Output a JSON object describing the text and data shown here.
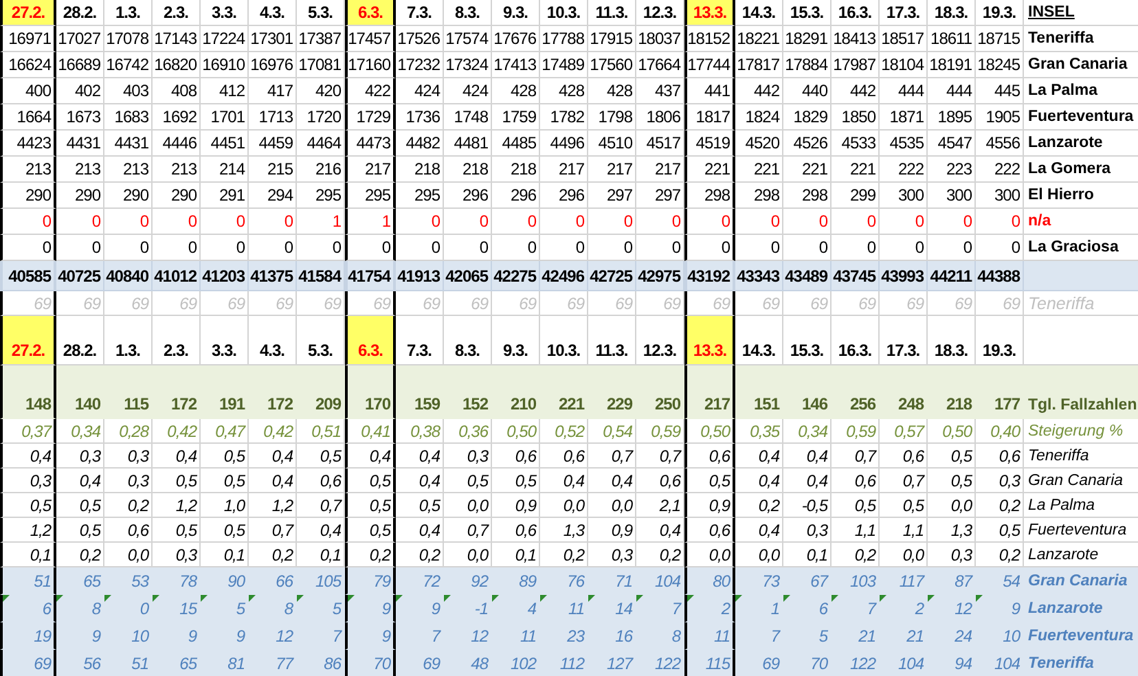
{
  "rows": [
    {
      "kind": "dates",
      "label": "INSEL",
      "cells": [
        {
          "text": "27.2.",
          "highlighted": true
        },
        {
          "text": "28.2.",
          "highlighted": false
        },
        {
          "text": "1.3.",
          "highlighted": false
        },
        {
          "text": "2.3.",
          "highlighted": false
        },
        {
          "text": "3.3.",
          "highlighted": false
        },
        {
          "text": "4.3.",
          "highlighted": false
        },
        {
          "text": "5.3.",
          "highlighted": false
        },
        {
          "text": "6.3.",
          "highlighted": true
        },
        {
          "text": "7.3.",
          "highlighted": false
        },
        {
          "text": "8.3.",
          "highlighted": false
        },
        {
          "text": "9.3.",
          "highlighted": false
        },
        {
          "text": "10.3.",
          "highlighted": false
        },
        {
          "text": "11.3.",
          "highlighted": false
        },
        {
          "text": "12.3.",
          "highlighted": false
        },
        {
          "text": "13.3.",
          "highlighted": true
        },
        {
          "text": "14.3.",
          "highlighted": false
        },
        {
          "text": "15.3.",
          "highlighted": false
        },
        {
          "text": "16.3.",
          "highlighted": false
        },
        {
          "text": "17.3.",
          "highlighted": false
        },
        {
          "text": "18.3.",
          "highlighted": false
        },
        {
          "text": "19.3.",
          "highlighted": false
        }
      ]
    },
    {
      "kind": "count",
      "label": "Teneriffa",
      "cells": [
        "16971",
        "17027",
        "17078",
        "17143",
        "17224",
        "17301",
        "17387",
        "17457",
        "17526",
        "17574",
        "17676",
        "17788",
        "17915",
        "18037",
        "18152",
        "18221",
        "18291",
        "18413",
        "18517",
        "18611",
        "18715"
      ]
    },
    {
      "kind": "count",
      "label": "Gran Canaria",
      "cells": [
        "16624",
        "16689",
        "16742",
        "16820",
        "16910",
        "16976",
        "17081",
        "17160",
        "17232",
        "17324",
        "17413",
        "17489",
        "17560",
        "17664",
        "17744",
        "17817",
        "17884",
        "17987",
        "18104",
        "18191",
        "18245"
      ]
    },
    {
      "kind": "count",
      "label": "La Palma",
      "cells": [
        "400",
        "402",
        "403",
        "408",
        "412",
        "417",
        "420",
        "422",
        "424",
        "424",
        "428",
        "428",
        "428",
        "437",
        "441",
        "442",
        "440",
        "442",
        "444",
        "444",
        "445"
      ]
    },
    {
      "kind": "count",
      "label": "Fuerteventura",
      "cells": [
        "1664",
        "1673",
        "1683",
        "1692",
        "1701",
        "1713",
        "1720",
        "1729",
        "1736",
        "1748",
        "1759",
        "1782",
        "1798",
        "1806",
        "1817",
        "1824",
        "1829",
        "1850",
        "1871",
        "1895",
        "1905"
      ]
    },
    {
      "kind": "count",
      "label": "Lanzarote",
      "cells": [
        "4423",
        "4431",
        "4431",
        "4446",
        "4451",
        "4459",
        "4464",
        "4473",
        "4482",
        "4481",
        "4485",
        "4496",
        "4510",
        "4517",
        "4519",
        "4520",
        "4526",
        "4533",
        "4535",
        "4547",
        "4556"
      ]
    },
    {
      "kind": "count",
      "label": "La Gomera",
      "cells": [
        "213",
        "213",
        "213",
        "213",
        "214",
        "215",
        "216",
        "217",
        "218",
        "218",
        "218",
        "217",
        "217",
        "217",
        "221",
        "221",
        "221",
        "221",
        "222",
        "223",
        "222"
      ]
    },
    {
      "kind": "count",
      "label": "El Hierro",
      "cells": [
        "290",
        "290",
        "290",
        "290",
        "291",
        "294",
        "295",
        "295",
        "295",
        "296",
        "296",
        "296",
        "297",
        "297",
        "298",
        "298",
        "298",
        "299",
        "300",
        "300",
        "300"
      ]
    },
    {
      "kind": "alert",
      "label": "n/a",
      "cells": [
        "0",
        "0",
        "0",
        "0",
        "0",
        "0",
        "1",
        "1",
        "0",
        "0",
        "0",
        "0",
        "0",
        "0",
        "0",
        "0",
        "0",
        "0",
        "0",
        "0",
        "0"
      ]
    },
    {
      "kind": "count",
      "label": "La Graciosa",
      "cells": [
        "0",
        "0",
        "0",
        "0",
        "0",
        "0",
        "0",
        "0",
        "0",
        "0",
        "0",
        "0",
        "0",
        "0",
        "0",
        "0",
        "0",
        "0",
        "0",
        "0",
        "0"
      ]
    },
    {
      "kind": "total",
      "cells": [
        "40585",
        "40725",
        "40840",
        "41012",
        "41203",
        "41375",
        "41584",
        "41754",
        "41913",
        "42065",
        "42275",
        "42496",
        "42725",
        "42975",
        "43192",
        "43343",
        "43489",
        "43745",
        "43993",
        "44211",
        "44388"
      ]
    },
    {
      "kind": "ghost",
      "label": "Teneriffa",
      "cells": [
        "69",
        "69",
        "69",
        "69",
        "69",
        "69",
        "69",
        "69",
        "69",
        "69",
        "69",
        "69",
        "69",
        "69",
        "69",
        "69",
        "69",
        "69",
        "69",
        "69",
        "69"
      ]
    },
    {
      "kind": "dates",
      "cells": [
        {
          "text": "27.2.",
          "highlighted": true
        },
        {
          "text": "28.2.",
          "highlighted": false
        },
        {
          "text": "1.3.",
          "highlighted": false
        },
        {
          "text": "2.3.",
          "highlighted": false
        },
        {
          "text": "3.3.",
          "highlighted": false
        },
        {
          "text": "4.3.",
          "highlighted": false
        },
        {
          "text": "5.3.",
          "highlighted": false
        },
        {
          "text": "6.3.",
          "highlighted": true
        },
        {
          "text": "7.3.",
          "highlighted": false
        },
        {
          "text": "8.3.",
          "highlighted": false
        },
        {
          "text": "9.3.",
          "highlighted": false
        },
        {
          "text": "10.3.",
          "highlighted": false
        },
        {
          "text": "11.3.",
          "highlighted": false
        },
        {
          "text": "12.3.",
          "highlighted": false
        },
        {
          "text": "13.3.",
          "highlighted": true
        },
        {
          "text": "14.3.",
          "highlighted": false
        },
        {
          "text": "15.3.",
          "highlighted": false
        },
        {
          "text": "16.3.",
          "highlighted": false
        },
        {
          "text": "17.3.",
          "highlighted": false
        },
        {
          "text": "18.3.",
          "highlighted": false
        },
        {
          "text": "19.3.",
          "highlighted": false
        }
      ]
    },
    {
      "kind": "daily",
      "label": "Tgl. Fallzahlen",
      "cells": [
        "148",
        "140",
        "115",
        "172",
        "191",
        "172",
        "209",
        "170",
        "159",
        "152",
        "210",
        "221",
        "229",
        "250",
        "217",
        "151",
        "146",
        "256",
        "248",
        "218",
        "177"
      ]
    },
    {
      "kind": "rate",
      "label": "Steigerung %",
      "cells": [
        "0,37",
        "0,34",
        "0,28",
        "0,42",
        "0,47",
        "0,42",
        "0,51",
        "0,41",
        "0,38",
        "0,36",
        "0,50",
        "0,52",
        "0,54",
        "0,59",
        "0,50",
        "0,35",
        "0,34",
        "0,59",
        "0,57",
        "0,50",
        "0,40"
      ]
    },
    {
      "kind": "share",
      "label": "Teneriffa",
      "cells": [
        "0,4",
        "0,3",
        "0,3",
        "0,4",
        "0,5",
        "0,4",
        "0,5",
        "0,4",
        "0,4",
        "0,3",
        "0,6",
        "0,6",
        "0,7",
        "0,7",
        "0,6",
        "0,4",
        "0,4",
        "0,7",
        "0,6",
        "0,5",
        "0,6"
      ]
    },
    {
      "kind": "share",
      "label": "Gran Canaria",
      "cells": [
        "0,3",
        "0,4",
        "0,3",
        "0,5",
        "0,5",
        "0,4",
        "0,6",
        "0,5",
        "0,4",
        "0,5",
        "0,5",
        "0,4",
        "0,4",
        "0,6",
        "0,5",
        "0,4",
        "0,4",
        "0,6",
        "0,7",
        "0,5",
        "0,3"
      ]
    },
    {
      "kind": "share",
      "label": "La Palma",
      "cells": [
        "0,5",
        "0,5",
        "0,2",
        "1,2",
        "1,0",
        "1,2",
        "0,7",
        "0,5",
        "0,5",
        "0,0",
        "0,9",
        "0,0",
        "0,0",
        "2,1",
        "0,9",
        "0,2",
        "-0,5",
        "0,5",
        "0,5",
        "0,0",
        "0,2"
      ]
    },
    {
      "kind": "share",
      "label": "Fuerteventura",
      "cells": [
        "1,2",
        "0,5",
        "0,6",
        "0,5",
        "0,5",
        "0,7",
        "0,4",
        "0,5",
        "0,4",
        "0,7",
        "0,6",
        "1,3",
        "0,9",
        "0,4",
        "0,6",
        "0,4",
        "0,3",
        "1,1",
        "1,1",
        "1,3",
        "0,5"
      ]
    },
    {
      "kind": "share",
      "label": "Lanzarote",
      "cells": [
        "0,1",
        "0,2",
        "0,0",
        "0,3",
        "0,1",
        "0,2",
        "0,1",
        "0,2",
        "0,2",
        "0,0",
        "0,1",
        "0,2",
        "0,3",
        "0,2",
        "0,0",
        "0,0",
        "0,1",
        "0,2",
        "0,0",
        "0,3",
        "0,2"
      ]
    },
    {
      "kind": "weekly",
      "label": "Gran Canaria",
      "error_markers": false,
      "cells": [
        "51",
        "65",
        "53",
        "78",
        "90",
        "66",
        "105",
        "79",
        "72",
        "92",
        "89",
        "76",
        "71",
        "104",
        "80",
        "73",
        "67",
        "103",
        "117",
        "87",
        "54"
      ]
    },
    {
      "kind": "weekly",
      "label": "Lanzarote",
      "error_markers": true,
      "cells": [
        "6",
        "8",
        "0",
        "15",
        "5",
        "8",
        "5",
        "9",
        "9",
        "-1",
        "4",
        "11",
        "14",
        "7",
        "2",
        "1",
        "6",
        "7",
        "2",
        "12",
        "9"
      ]
    },
    {
      "kind": "weekly",
      "label": "Fuerteventura",
      "error_markers": false,
      "cells": [
        "19",
        "9",
        "10",
        "9",
        "9",
        "12",
        "7",
        "9",
        "7",
        "12",
        "11",
        "23",
        "16",
        "8",
        "11",
        "7",
        "5",
        "21",
        "21",
        "24",
        "10"
      ]
    },
    {
      "kind": "weekly",
      "label": "Teneriffa",
      "error_markers": false,
      "cells": [
        "69",
        "56",
        "51",
        "65",
        "81",
        "77",
        "86",
        "70",
        "69",
        "48",
        "102",
        "112",
        "127",
        "122",
        "115",
        "69",
        "70",
        "122",
        "104",
        "94",
        "104"
      ]
    }
  ]
}
